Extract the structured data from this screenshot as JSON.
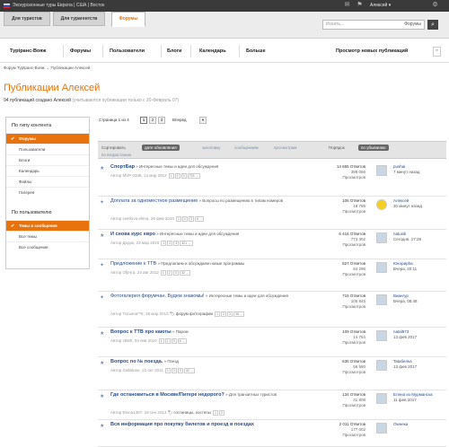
{
  "topbar": {
    "title": "Экскурсионные туры Европа | США | Восток",
    "user": "Алексей ▾"
  },
  "tabs": [
    {
      "label": "Для туристов"
    },
    {
      "label": "Для турагентств"
    },
    {
      "label": "Форумы"
    }
  ],
  "search": {
    "placeholder": "Искать...",
    "scope": "Форумы"
  },
  "nav": {
    "items": [
      "Турtранс-Вояж",
      "Форумы",
      "Пользователи",
      "Блоги",
      "Календарь",
      "Больше"
    ],
    "right": "Просмотр новых публикаций"
  },
  "breadcrumbs": "Форум Турtранс-Вояж  →  Публикации Алексей",
  "page": {
    "title": "Публикации Алексей",
    "subtitle": "94 публикаций создано Алексей",
    "subtitle_note": "(учитываются публикации только с 20-Февраль 07)"
  },
  "sidebar": {
    "section1_title": "По типу контента",
    "section1_items": [
      "Форумы",
      "Пользователи",
      "Блоги",
      "Календарь",
      "Файлы",
      "Галерея"
    ],
    "section2_title": "По пользователю",
    "section2_items": [
      "Темы и сообщения",
      "Все темы",
      "Все сообщения"
    ]
  },
  "pager": {
    "label": "Страница 1 из 4",
    "pages": [
      "1",
      "2",
      "3"
    ],
    "next": "Вперед"
  },
  "sortbar": {
    "sort_label": "Сортировать",
    "options": [
      "дате обновления",
      "заголовку",
      "сообщениям",
      "просмотрам"
    ],
    "extra": "по возрастанию",
    "order_label": "Порядок",
    "order_value": "по убыванию"
  },
  "topics": [
    {
      "title": "СпортБар",
      "cat": " » Интересные темы и идеи для обсуждения",
      "meta": "Автор МVP 0106, 13 мар 2012",
      "pages": [
        "1",
        "2",
        "3"
      ],
      "more": "733 →",
      "answers": "14 655 Ответов",
      "views": "398 056",
      "views_label": "Просмотров",
      "user": "pushai",
      "time": "7 минут назад",
      "bold": true
    },
    {
      "title": "Доплата за одноместное размещение",
      "cat": " » Вопросы по размещению в типам номеров",
      "meta": "Автор svetlova elena, 28 фев 2010",
      "pages": [
        "1",
        "2",
        "3"
      ],
      "more": "6 →",
      "answers": "106 Ответов",
      "views": "18 785",
      "views_label": "Просмотров",
      "user": "Алексей",
      "time": "30 минут назад",
      "bold": false
    },
    {
      "title": "И снова курс евро",
      "cat": " » Интересные темы и идеи для обсуждения",
      "meta": "Автор Дедок, 23 мар 2010",
      "pages": [
        "1",
        "2",
        "3"
      ],
      "more": "321 →",
      "answers": "6 416 Ответов",
      "views": "773 302",
      "views_label": "Просмотров",
      "user": "natusik",
      "time": "Сегодня, 17:29",
      "bold": true
    },
    {
      "title": "Предложение к ТТВ",
      "cat": " » Предлагаем и обсуждаем новые программы",
      "meta": "Автор Ofjerra, 24 авг 2012",
      "pages": [
        "1",
        "2",
        "3"
      ],
      "more": "32 →",
      "answers": "627 Ответов",
      "views": "84 295",
      "views_label": "Просмотров",
      "user": "Юкориpha",
      "time": "Вчера, 20:11",
      "bold": false
    },
    {
      "title": "Фотогалерея форумчан. Будем знакомы!",
      "cat": " » Интересные темы и идеи для обсуждения",
      "meta": "Автор Татьяна**К, 18 мар 2013",
      "tag": "форум фотографии",
      "pages": [
        "1",
        "2",
        "3"
      ],
      "more": "36 →",
      "answers": "715 Ответов",
      "views": "105 845",
      "views_label": "Просмотров",
      "user": "Виангур",
      "time": "Вчера, 08:48",
      "bold": false
    },
    {
      "title": "Вопрос к ТТВ про каюты",
      "cat": " » Паром",
      "meta": "Автор stk80, 04 янв 2010",
      "pages": [
        "1",
        "2",
        "3"
      ],
      "more": "6 →",
      "answers": "109 Ответов",
      "views": "14 754",
      "views_label": "Просмотров",
      "user": "natal973",
      "time": "13 фев 2017",
      "bold": true
    },
    {
      "title": "Вопрос по № поезда.",
      "cat": " » Поезд",
      "meta": "Автор Gallalune, 22 окт 2011",
      "pages": [
        "1",
        "2",
        "3"
      ],
      "more": "32 →",
      "answers": "635 Ответов",
      "views": "56 580",
      "views_label": "Просмотров",
      "user": "Tatабелка",
      "time": "13 фев 2017",
      "bold": true
    },
    {
      "title": "Где остановиться в Москве/Питере недорого?",
      "cat": " » Для транзитных туристов",
      "meta": "Автор Elena1307, 18 сен 2013",
      "tag": "гостиницы, хостелы",
      "pages": [
        "1",
        "2"
      ],
      "more": "",
      "answers": "134 Ответов",
      "views": "31 808",
      "views_label": "Просмотров",
      "user": "Елена из Мурманска",
      "time": "11 фев 2017",
      "bold": true
    },
    {
      "title": "Вся информация про покупку билетов и проезд в поездах",
      "cat": "",
      "meta": "",
      "pages": [],
      "more": "",
      "answers": "2 011 Ответов",
      "views": "177 002",
      "views_label": "Просмотров",
      "user": "Owнeка",
      "time": "",
      "bold": true
    }
  ]
}
